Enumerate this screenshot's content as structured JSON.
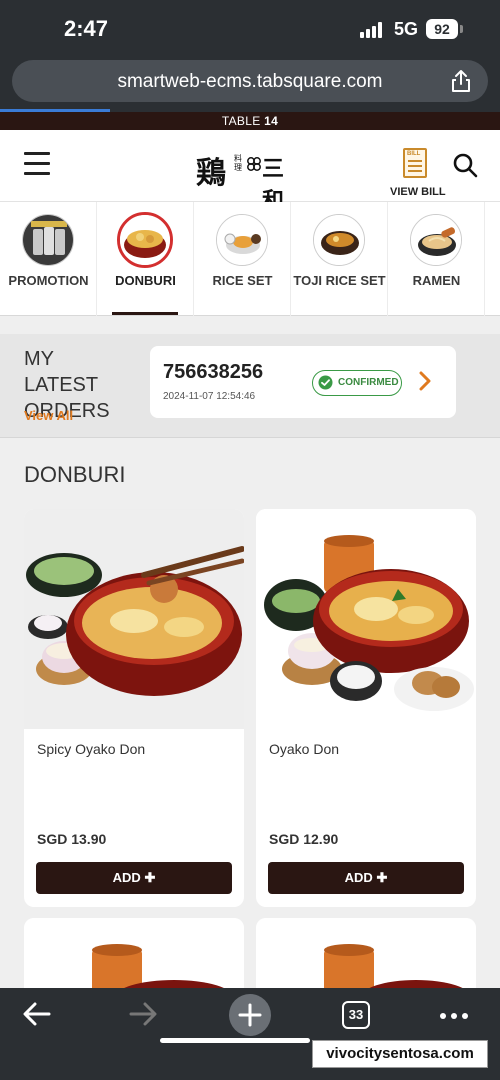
{
  "status_bar": {
    "time": "2:47",
    "network": "5G",
    "battery": "92"
  },
  "browser": {
    "url": "smartweb-ecms.tabsquare.com",
    "tabs_count": "33"
  },
  "table_bar": {
    "prefix": "TABLE",
    "number": "14"
  },
  "header": {
    "logo_main": "鶏",
    "logo_small": "料理",
    "logo_name": "三和",
    "view_bill": "VIEW BILL",
    "bill_icon_text": "BILL"
  },
  "categories": [
    {
      "label": "PROMOTION",
      "active": false
    },
    {
      "label": "DONBURI",
      "active": true
    },
    {
      "label": "RICE SET",
      "active": false
    },
    {
      "label": "TOJI RICE SET",
      "active": false
    },
    {
      "label": "RAMEN",
      "active": false
    }
  ],
  "latest_orders": {
    "title": "MY LATEST ORDERS",
    "view_all": "View All",
    "order_number": "756638256",
    "order_time": "2024-11-07 12:54:46",
    "status": "CONFIRMED"
  },
  "section": {
    "title": "DONBURI"
  },
  "products": [
    {
      "name": "Spicy Oyako Don",
      "price": "SGD 13.90",
      "add_label": "ADD"
    },
    {
      "name": "Oyako Don",
      "price": "SGD 12.90",
      "add_label": "ADD"
    }
  ],
  "colors": {
    "brand_dark": "#2a1612",
    "accent_orange": "#e07a1f",
    "confirmed_green": "#3a9a46",
    "active_red": "#d32f2f"
  },
  "watermark": "vivocitysentosa.com"
}
